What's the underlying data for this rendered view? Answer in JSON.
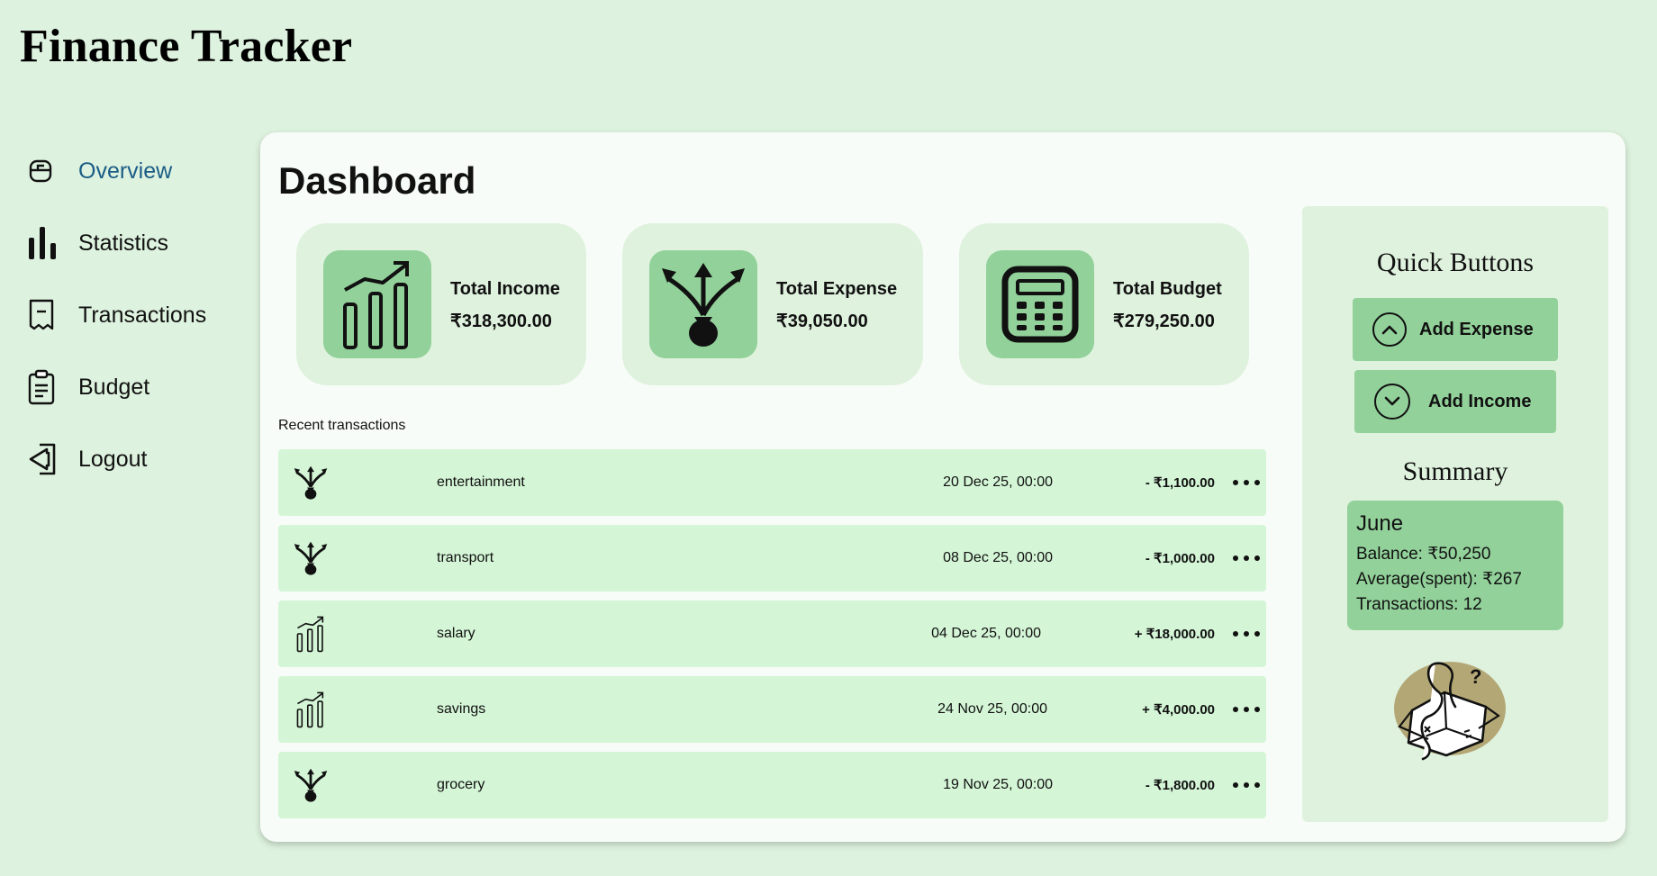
{
  "app": {
    "title": "Finance Tracker"
  },
  "sidebar": {
    "items": [
      {
        "label": "Overview",
        "icon": "overview-icon",
        "active": true
      },
      {
        "label": "Statistics",
        "icon": "statistics-icon",
        "active": false
      },
      {
        "label": "Transactions",
        "icon": "receipt-icon",
        "active": false
      },
      {
        "label": "Budget",
        "icon": "clipboard-icon",
        "active": false
      },
      {
        "label": "Logout",
        "icon": "logout-icon",
        "active": false
      }
    ]
  },
  "dashboard": {
    "title": "Dashboard",
    "cards": [
      {
        "label": "Total Income",
        "value": "₹318,300.00",
        "icon": "income-chart-icon"
      },
      {
        "label": "Total Expense",
        "value": "₹39,050.00",
        "icon": "money-bag-split-icon"
      },
      {
        "label": "Total Budget",
        "value": "₹279,250.00",
        "icon": "calculator-icon"
      }
    ],
    "recent_label": "Recent transactions",
    "transactions": [
      {
        "category": "entertainment",
        "date": "20 Dec 25, 00:00",
        "amount": "- ₹1,100.00",
        "type": "expense"
      },
      {
        "category": "transport",
        "date": "08 Dec 25, 00:00",
        "amount": "- ₹1,000.00",
        "type": "expense"
      },
      {
        "category": "salary",
        "date": "04 Dec 25, 00:00",
        "amount": "+ ₹18,000.00",
        "type": "income"
      },
      {
        "category": "savings",
        "date": "24 Nov 25, 00:00",
        "amount": "+ ₹4,000.00",
        "type": "income"
      },
      {
        "category": "grocery",
        "date": "19 Nov 25, 00:00",
        "amount": "- ₹1,800.00",
        "type": "expense"
      }
    ]
  },
  "quick_buttons": {
    "title": "Quick Buttons",
    "add_expense": "Add Expense",
    "add_income": "Add Income"
  },
  "summary": {
    "title": "Summary",
    "month": "June",
    "balance": "Balance: ₹50,250",
    "average": "Average(spent): ₹267",
    "transactions": "Transactions: 12"
  },
  "colors": {
    "background": "#def3df",
    "panel": "#f8fcf8",
    "card": "#dff2de",
    "accent": "#92d19a",
    "row": "#d4f5d6",
    "active_nav": "#1b5d86",
    "illustration_blob": "#b3a775"
  }
}
